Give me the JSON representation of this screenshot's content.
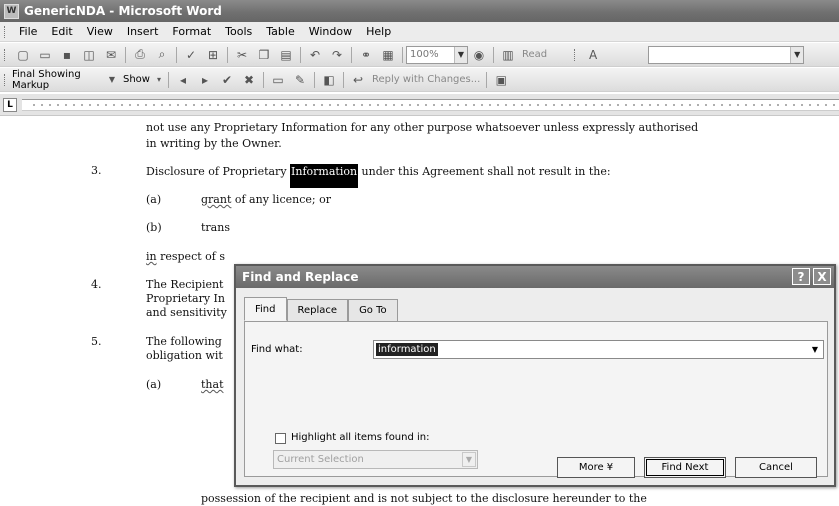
{
  "window": {
    "title": "GenericNDA - Microsoft Word"
  },
  "menu": [
    "File",
    "Edit",
    "View",
    "Insert",
    "Format",
    "Tools",
    "Table",
    "Window",
    "Help"
  ],
  "toolbar": {
    "zoom": "100%",
    "read_label": "Read",
    "review_mode": "Final Showing Markup",
    "show_label": "Show",
    "reply_label": "Reply with Changes..."
  },
  "document": {
    "line1": "not use any Proprietary Information for any other purpose whatsoever unless expressly authorised",
    "line2": "in writing by the Owner.",
    "item3_num": "3.",
    "item3_pre": "Disclosure of Proprietary ",
    "item3_highlight": "Information",
    "item3_post": " under this Agreement shall not result in the:",
    "a1_label": "(a)",
    "a1_word": "grant",
    "a1_rest": " of any licence; or",
    "b_label": "(b)",
    "b_text": "trans",
    "respect_pre": "in",
    "respect_post": " respect of s",
    "item4_num": "4.",
    "item4_l1": "The Recipient",
    "item4_l2": "Proprietary In",
    "item4_l3": "and sensitivity",
    "item5_num": "5.",
    "item5_l1": "The  following",
    "item5_l2": "obligation wit",
    "a2_label": "(a)",
    "a2_word": "that",
    "a2_l2": "possession of the recipient and is not subject to the disclosure hereunder to the"
  },
  "dialog": {
    "title": "Find and Replace",
    "help": "?",
    "close": "X",
    "tabs": [
      "Find",
      "Replace",
      "Go To"
    ],
    "find_label": "Find what:",
    "find_value": "information",
    "highlight_label": "Highlight all items found in:",
    "scope_value": "Current Selection",
    "more_label": "More ¥",
    "find_next_label": "Find Next",
    "cancel_label": "Cancel"
  }
}
